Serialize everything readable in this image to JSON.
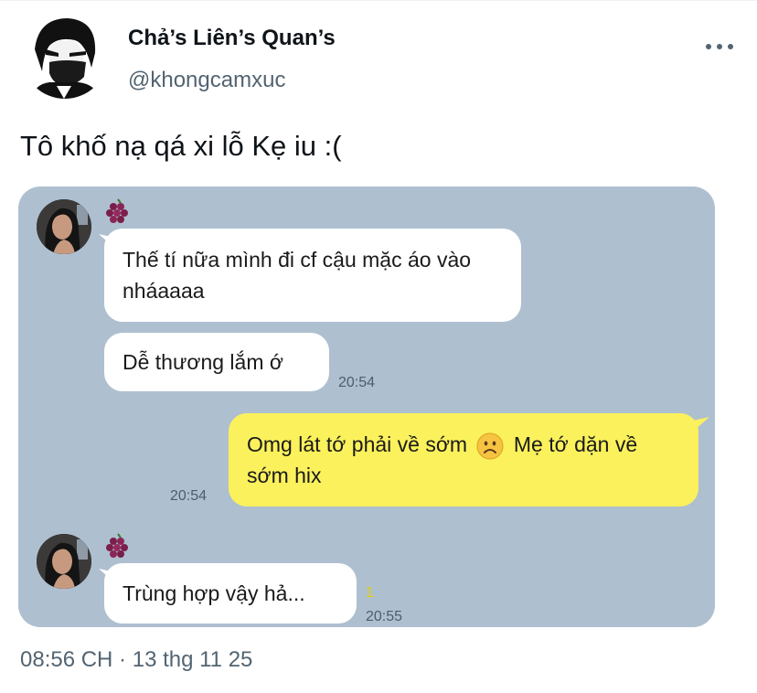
{
  "author": {
    "display_name": "Chả’s Liên’s Quan’s",
    "handle": "@khongcamxuc"
  },
  "tweet": {
    "text": "Tô khố nạ qá xi lỗ Kẹ iu :(",
    "timestamp": "08:56 CH · 13 thg 11 25"
  },
  "chat": {
    "messages": [
      {
        "side": "left",
        "text": "Thế tí nữa mình đi cf cậu mặc áo vào nháaaaa",
        "time": ""
      },
      {
        "side": "left",
        "text": "Dễ thương lắm ớ",
        "time": "20:54"
      },
      {
        "side": "right",
        "text_before": "Omg lát tớ phải về sớm",
        "emoji": "frowning-face",
        "text_after": "Mẹ tớ dặn về sớm hix",
        "time": "20:54"
      },
      {
        "side": "left",
        "text": "Trùng hợp vậy hả...",
        "read": "1",
        "time": "20:55"
      }
    ]
  },
  "colors": {
    "chat_bg": "#aebfd0",
    "bubble_white": "#ffffff",
    "bubble_yellow": "#fbf15c",
    "secondary_text": "#536471"
  },
  "icons": {
    "more": "more-horizontal-icon",
    "grape": "grape-icon",
    "emoji": "frowning-face-emoji"
  }
}
